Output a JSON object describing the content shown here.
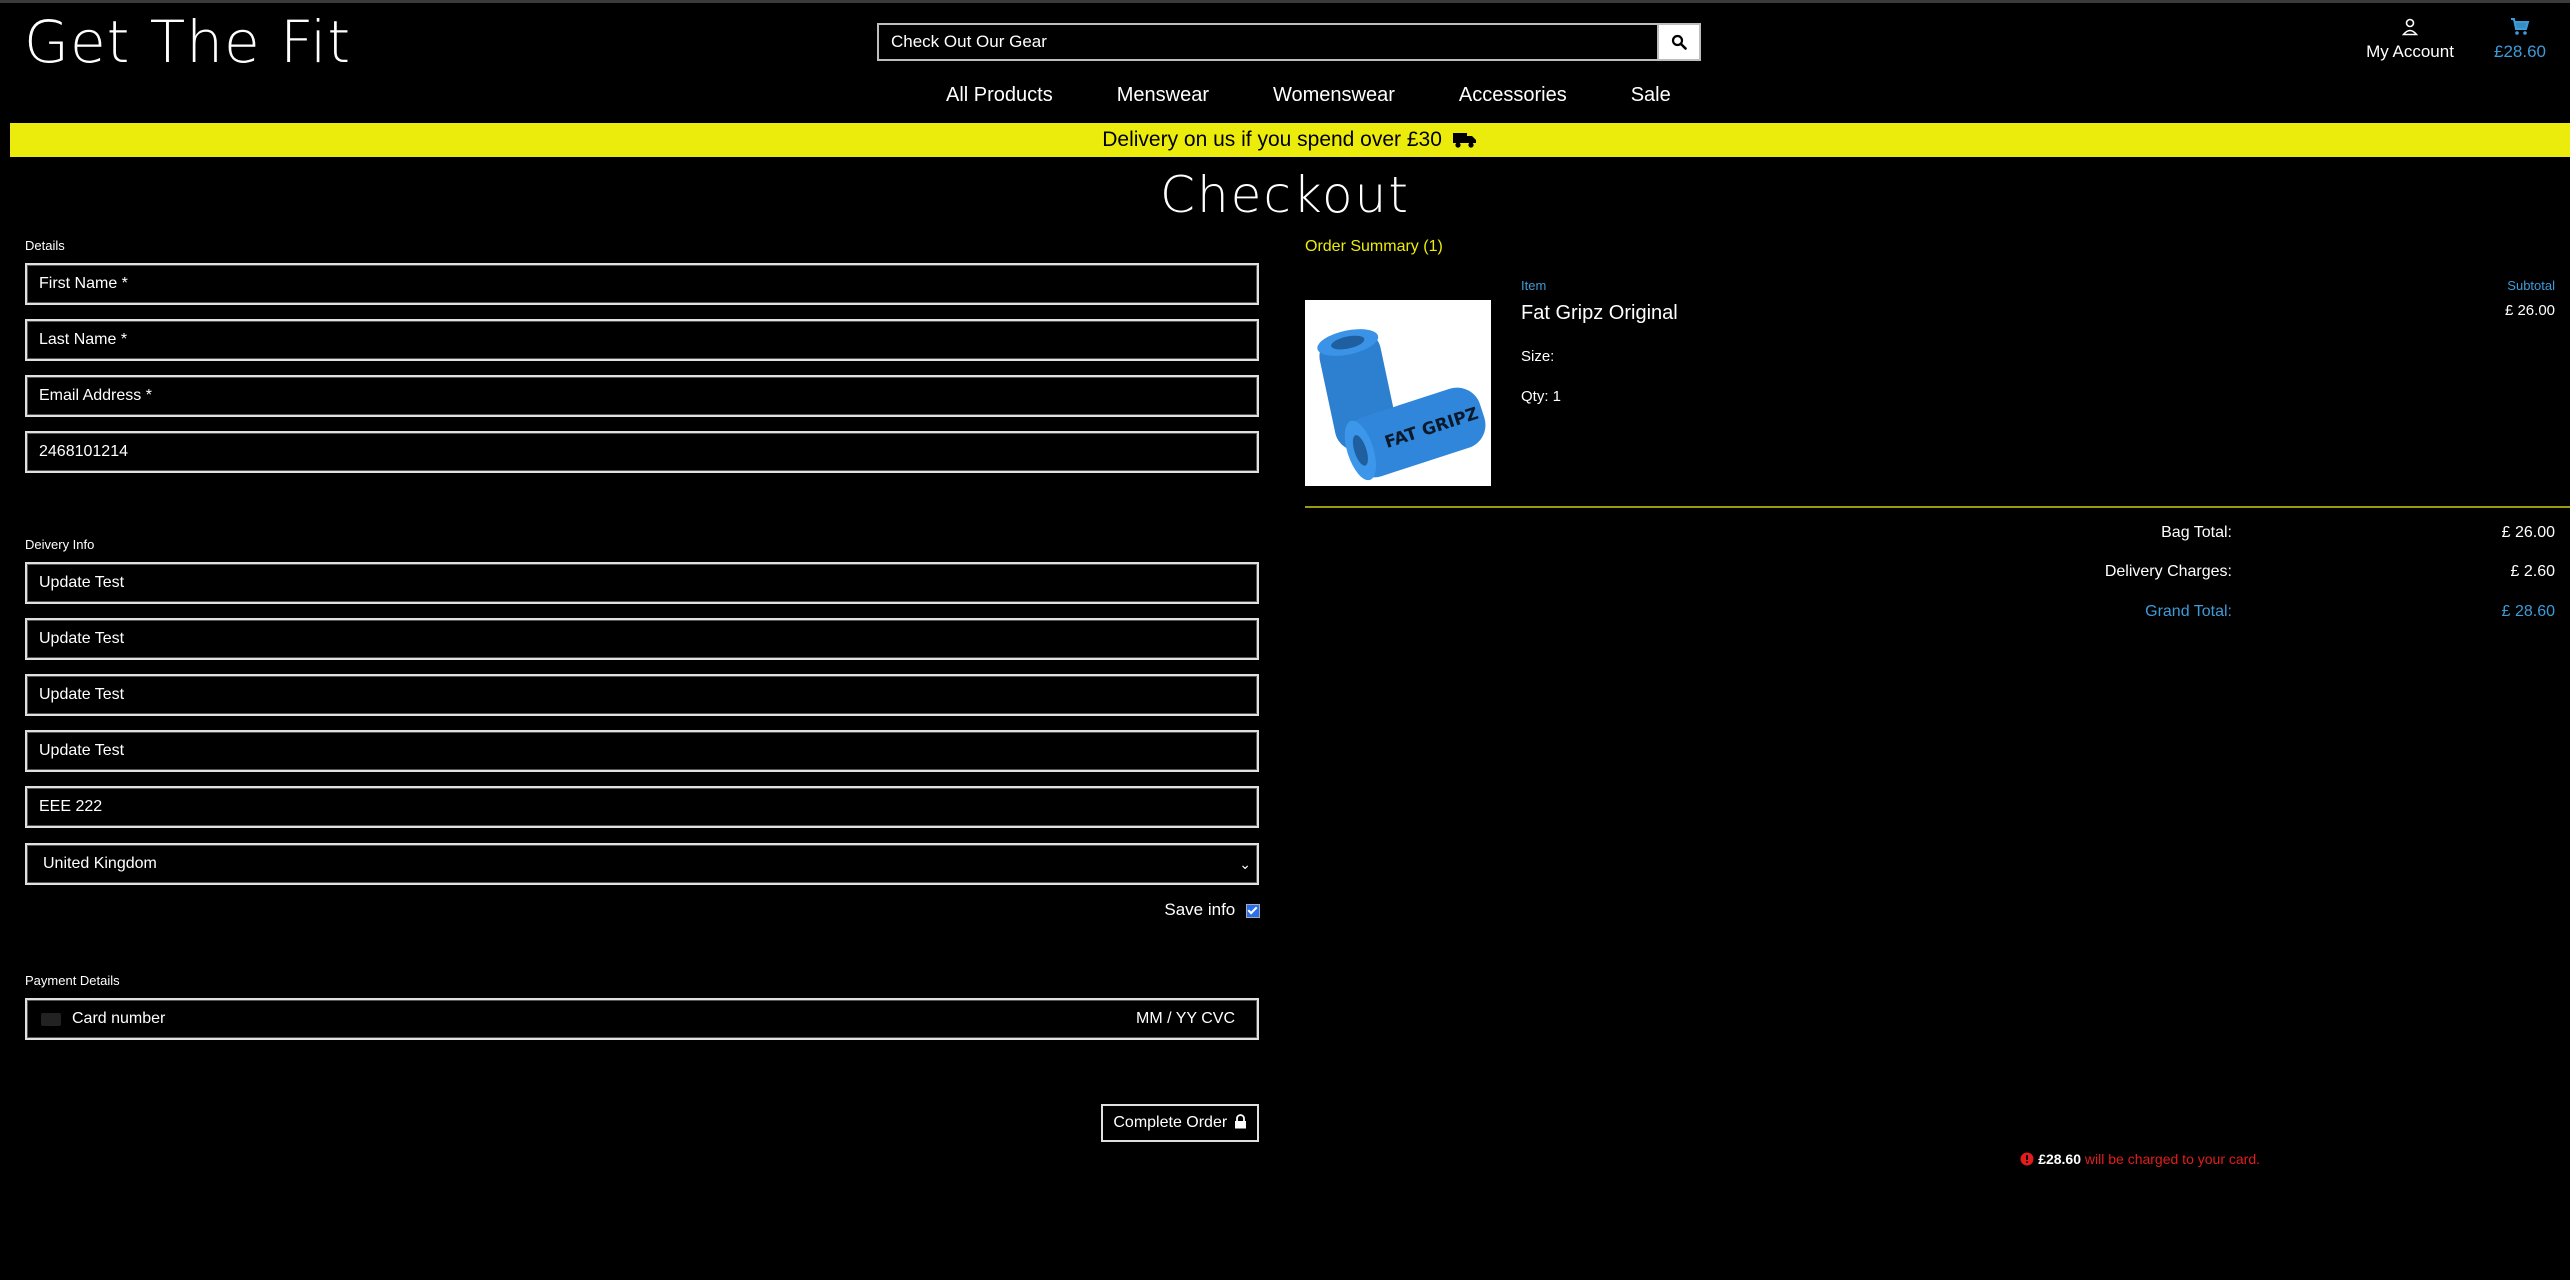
{
  "header": {
    "logo": "Get The Fit",
    "search_placeholder": "Check Out Our Gear",
    "account_label": "My Account",
    "bag_total": "£28.60"
  },
  "nav": {
    "items": [
      "All Products",
      "Menswear",
      "Womenswear",
      "Accessories",
      "Sale"
    ]
  },
  "banner": {
    "text": "Delivery on us if you spend over £30"
  },
  "page": {
    "title": "Checkout"
  },
  "details": {
    "label": "Details",
    "first_name": "First Name *",
    "last_name": "Last Name *",
    "email": "Email Address *",
    "phone": "2468101214"
  },
  "delivery": {
    "label": "Deivery Info",
    "line1": "Update Test",
    "line2": "Update Test",
    "line3": "Update Test",
    "line4": "Update Test",
    "postcode": "EEE 222",
    "country": "United Kingdom",
    "save_info": "Save info",
    "save_checked": true
  },
  "payment": {
    "label": "Payment Details",
    "card_number": "Card number",
    "expiry_cvc": "MM / YY  CVC",
    "complete_button": "Complete Order",
    "charge_amount": "£28.60",
    "charge_text": "will be charged to your card."
  },
  "order_summary": {
    "title": "Order Summary (1)",
    "col_item": "Item",
    "col_subtotal": "Subtotal",
    "product_name": "Fat Gripz Original",
    "product_price": "£ 26.00",
    "size_label": "Size:",
    "qty_label": "Qty: 1",
    "image_text": "FAT GRIPZ",
    "bag_total_label": "Bag Total:",
    "bag_total_value": "£ 26.00",
    "delivery_label": "Delivery Charges:",
    "delivery_value": "£ 2.60",
    "grand_label": "Grand Total:",
    "grand_value": "£ 28.60"
  }
}
